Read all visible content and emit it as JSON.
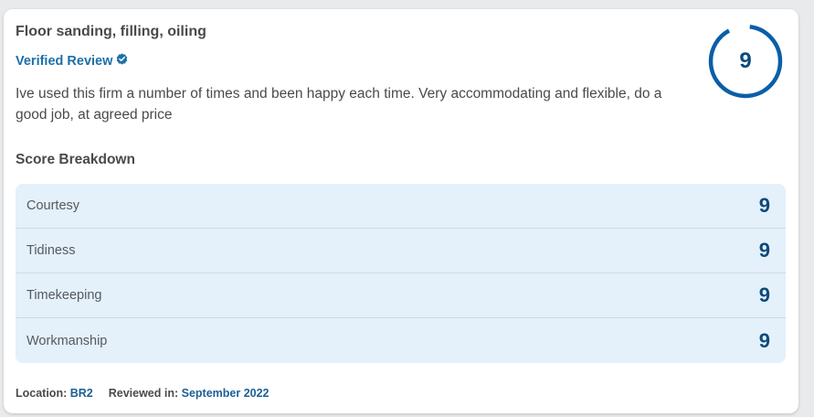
{
  "review": {
    "job_title": "Floor sanding, filling, oiling",
    "verified_label": "Verified Review",
    "text": "Ive used this firm a number of times and been happy each time. Very accommodating and flexible, do a good job, at agreed price",
    "overall_score": "9",
    "overall_fraction": 0.9
  },
  "breakdown": {
    "title": "Score Breakdown",
    "rows": [
      {
        "category": "Courtesy",
        "score": "9"
      },
      {
        "category": "Tidiness",
        "score": "9"
      },
      {
        "category": "Timekeeping",
        "score": "9"
      },
      {
        "category": "Workmanship",
        "score": "9"
      }
    ]
  },
  "footer": {
    "location_label": "Location:",
    "location_value": "BR2",
    "reviewed_label": "Reviewed in:",
    "reviewed_value": "September 2022"
  },
  "icons": {
    "verified": "verified-check-icon"
  },
  "colors": {
    "accent": "#0b5ea8",
    "score_text": "#0b4a7c",
    "breakdown_bg": "#e4f0fa",
    "link": "#1d6fa8"
  }
}
